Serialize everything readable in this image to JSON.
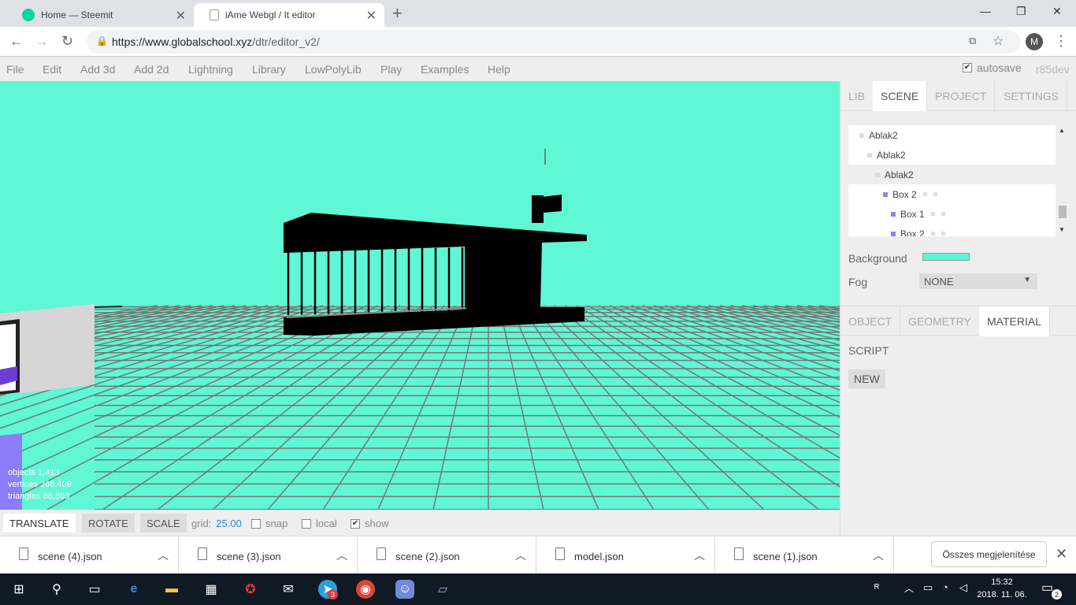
{
  "browser": {
    "tabs": [
      {
        "title": "Home — Steemit",
        "active": false
      },
      {
        "title": "iAme Webgl / It editor",
        "active": true
      }
    ],
    "url_host": "https://www.globalschool.xyz",
    "url_path": "/dtr/editor_v2/",
    "profile_initial": "M"
  },
  "menubar": {
    "items": [
      "File",
      "Edit",
      "Add 3d",
      "Add 2d",
      "Lightning",
      "Library",
      "LowPolyLib",
      "Play",
      "Examples",
      "Help"
    ],
    "autosave_label": "autosave",
    "autosave_checked": true,
    "revision": "r85dev"
  },
  "viewport": {
    "background_color": "#5ff7d5",
    "info": {
      "objects": "objects 1,413",
      "vertices": "vertices 266,409",
      "triangles": "triangles 88,803"
    }
  },
  "toolbar": {
    "translate": "TRANSLATE",
    "rotate": "ROTATE",
    "scale": "SCALE",
    "grid_label": "grid:",
    "grid_value": "25.00",
    "snap": "snap",
    "local": "local",
    "show": "show",
    "show_checked": true
  },
  "sidebar": {
    "top_tabs": [
      "LIB",
      "SCENE",
      "PROJECT",
      "SETTINGS"
    ],
    "active_top_tab": "SCENE",
    "outliner": [
      {
        "label": "Ablak2",
        "depth": 0,
        "type": "group"
      },
      {
        "label": "Ablak2",
        "depth": 1,
        "type": "group"
      },
      {
        "label": "Ablak2",
        "depth": 2,
        "type": "group",
        "selected": true
      },
      {
        "label": "Box 2",
        "depth": 3,
        "type": "mesh"
      },
      {
        "label": "Box 1",
        "depth": 4,
        "type": "mesh"
      },
      {
        "label": "Box 2",
        "depth": 4,
        "type": "mesh"
      }
    ],
    "background_label": "Background",
    "background_color": "#5ff7d5",
    "fog_label": "Fog",
    "fog_value": "NONE",
    "prop_tabs": [
      "OBJECT",
      "GEOMETRY",
      "MATERIAL"
    ],
    "active_prop_tab": "MATERIAL",
    "script_label": "SCRIPT",
    "new_button": "NEW"
  },
  "downloads": {
    "files": [
      "scene (4).json",
      "scene (3).json",
      "scene (2).json",
      "model.json",
      "scene (1).json"
    ],
    "show_all": "Összes megjelenítése"
  },
  "taskbar": {
    "telegram_badge": "3",
    "time": "15:32",
    "date": "2018. 11. 06.",
    "notifications": "2"
  }
}
